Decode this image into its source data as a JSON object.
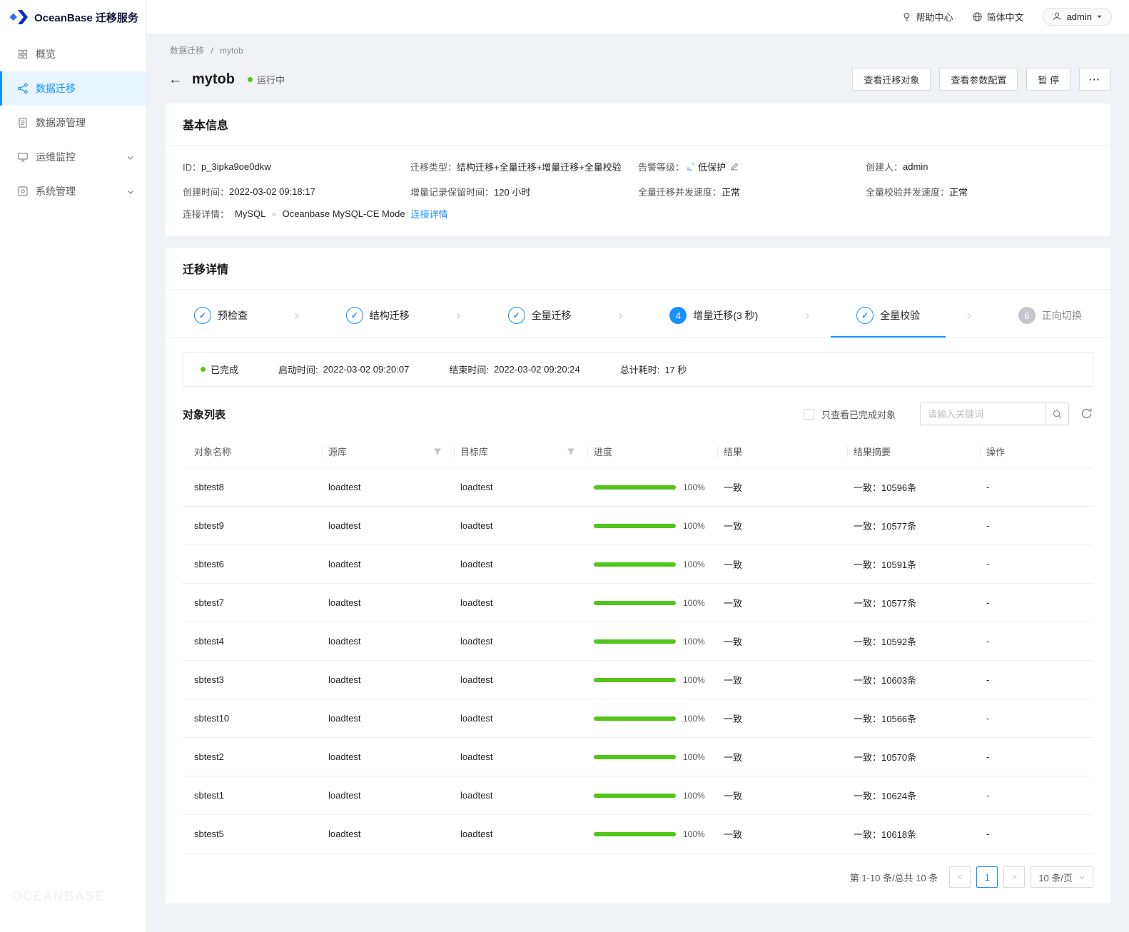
{
  "colors": {
    "accent": "#1890ff",
    "success": "#52c41a"
  },
  "brand": {
    "title": "OceanBase 迁移服务"
  },
  "topbar": {
    "help": "帮助中心",
    "language": "简体中文",
    "user": "admin"
  },
  "sidebar": {
    "items": [
      {
        "label": "概览"
      },
      {
        "label": "数据迁移"
      },
      {
        "label": "数据源管理"
      },
      {
        "label": "运维监控"
      },
      {
        "label": "系统管理"
      }
    ],
    "watermark": "OCEANBASE"
  },
  "breadcrumb": {
    "root": "数据迁移",
    "separator": "/",
    "current": "mytob"
  },
  "page": {
    "title": "mytob",
    "status": "运行中",
    "view_objects": "查看迁移对象",
    "view_params": "查看参数配置",
    "pause": "暂 停",
    "more": "···"
  },
  "basic_info": {
    "title": "基本信息",
    "fields": [
      {
        "label": "ID：",
        "value": "p_3ipka9oe0dkw"
      },
      {
        "label": "迁移类型：",
        "value": "结构迁移+全量迁移+增量迁移+全量校验"
      },
      {
        "label": "告警等级：",
        "value": "低保护"
      },
      {
        "label": "创建人：",
        "value": "admin"
      },
      {
        "label": "创建时间：",
        "value": "2022-03-02 09:18:17"
      },
      {
        "label": "增量记录保留时间：",
        "value": "120 小时"
      },
      {
        "label": "全量迁移并发速度：",
        "value": "正常"
      },
      {
        "label": "全量校验并发速度：",
        "value": "正常"
      }
    ],
    "connection": {
      "label": "连接详情：",
      "source": "MySQL",
      "arrow": "»",
      "target": "Oceanbase MySQL-CE Mode",
      "link": "连接详情"
    }
  },
  "migration": {
    "title": "迁移详情",
    "steps": [
      {
        "label": "预检查",
        "state": "done"
      },
      {
        "label": "结构迁移",
        "state": "done"
      },
      {
        "label": "全量迁移",
        "state": "done"
      },
      {
        "label": "增量迁移(3 秒)",
        "state": "current",
        "num": "4"
      },
      {
        "label": "全量校验",
        "state": "done-active"
      },
      {
        "label": "正向切换",
        "state": "pending",
        "num": "6"
      }
    ],
    "status": {
      "state": "已完成",
      "start_label": "启动时间:",
      "start_value": "2022-03-02 09:20:07",
      "end_label": "结束时间:",
      "end_value": "2022-03-02 09:20:24",
      "total_label": "总计耗时:",
      "total_value": "17 秒"
    }
  },
  "object_list": {
    "title": "对象列表",
    "filter_label": "只查看已完成对象",
    "search_placeholder": "请输入关键词",
    "columns": [
      "对象名称",
      "源库",
      "目标库",
      "进度",
      "结果",
      "结果摘要",
      "操作"
    ],
    "rows": [
      {
        "name": "sbtest8",
        "source": "loadtest",
        "target": "loadtest",
        "progress_text": "100%",
        "result": "一致",
        "summary": "一致：10596条",
        "op": "-"
      },
      {
        "name": "sbtest9",
        "source": "loadtest",
        "target": "loadtest",
        "progress_text": "100%",
        "result": "一致",
        "summary": "一致：10577条",
        "op": "-"
      },
      {
        "name": "sbtest6",
        "source": "loadtest",
        "target": "loadtest",
        "progress_text": "100%",
        "result": "一致",
        "summary": "一致：10591条",
        "op": "-"
      },
      {
        "name": "sbtest7",
        "source": "loadtest",
        "target": "loadtest",
        "progress_text": "100%",
        "result": "一致",
        "summary": "一致：10577条",
        "op": "-"
      },
      {
        "name": "sbtest4",
        "source": "loadtest",
        "target": "loadtest",
        "progress_text": "100%",
        "result": "一致",
        "summary": "一致：10592条",
        "op": "-"
      },
      {
        "name": "sbtest3",
        "source": "loadtest",
        "target": "loadtest",
        "progress_text": "100%",
        "result": "一致",
        "summary": "一致：10603条",
        "op": "-"
      },
      {
        "name": "sbtest10",
        "source": "loadtest",
        "target": "loadtest",
        "progress_text": "100%",
        "result": "一致",
        "summary": "一致：10566条",
        "op": "-"
      },
      {
        "name": "sbtest2",
        "source": "loadtest",
        "target": "loadtest",
        "progress_text": "100%",
        "result": "一致",
        "summary": "一致：10570条",
        "op": "-"
      },
      {
        "name": "sbtest1",
        "source": "loadtest",
        "target": "loadtest",
        "progress_text": "100%",
        "result": "一致",
        "summary": "一致：10624条",
        "op": "-"
      },
      {
        "name": "sbtest5",
        "source": "loadtest",
        "target": "loadtest",
        "progress_text": "100%",
        "result": "一致",
        "summary": "一致：10618条",
        "op": "-"
      }
    ],
    "pagination": {
      "total": "第 1-10 条/总共 10 条",
      "prev": "<",
      "page": "1",
      "next": ">",
      "page_size": "10 条/页"
    }
  }
}
